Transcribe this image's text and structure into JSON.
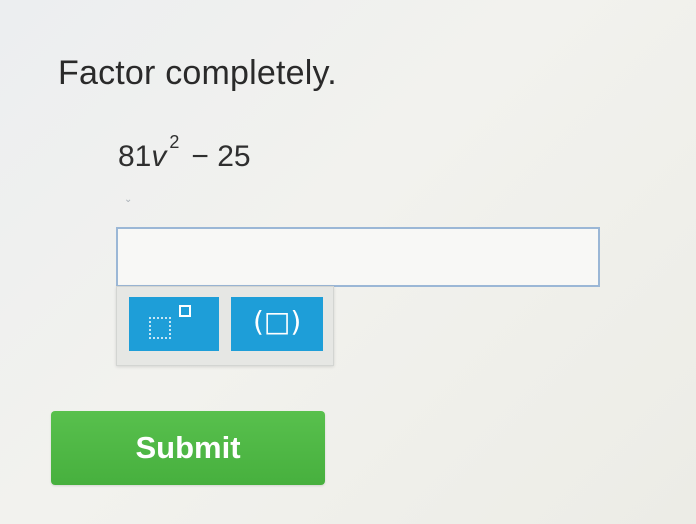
{
  "question": {
    "prompt": "Factor completely.",
    "expression": {
      "coefficient": "81",
      "variable": "v",
      "exponent": "2",
      "rest": "− 25"
    }
  },
  "answer": {
    "value": "",
    "placeholder": ""
  },
  "toolbar": {
    "exponent_icon": "superscript-template-icon",
    "parentheses_icon": "parentheses-template-icon",
    "parentheses_label": "(□)"
  },
  "actions": {
    "submit_label": "Submit"
  },
  "colors": {
    "tool_button": "#1e9ed8",
    "submit_button": "#4fb845",
    "input_border": "#9bb7d6"
  }
}
